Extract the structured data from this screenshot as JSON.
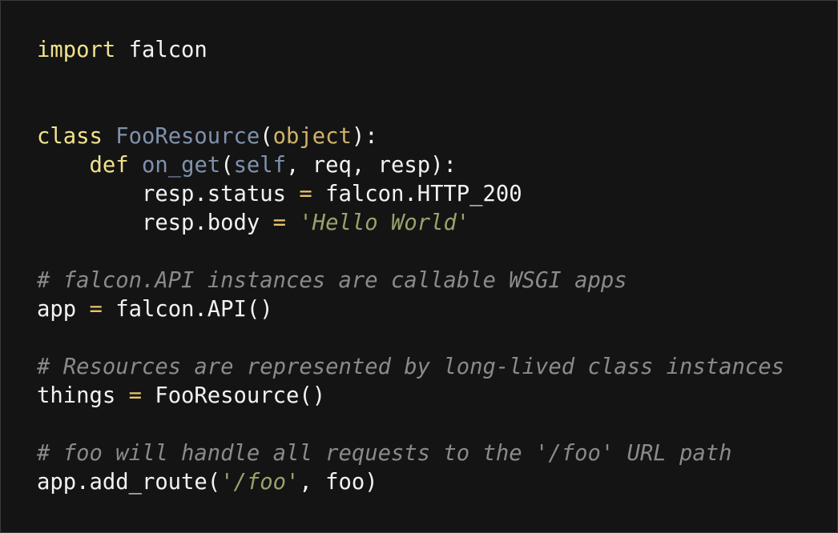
{
  "code": {
    "language": "python",
    "colors": {
      "background": "#141414",
      "keyword": "#f0e28c",
      "classname": "#7f91ad",
      "builtin": "#d0b26a",
      "operator": "#e8c46a",
      "string": "#9aa26a",
      "comment": "#8a8a8a",
      "text": "#f2f2f2"
    },
    "lines": [
      [
        {
          "t": "import",
          "k": "keyword"
        },
        {
          "t": " falcon",
          "k": "plain"
        }
      ],
      [],
      [],
      [
        {
          "t": "class",
          "k": "keyword"
        },
        {
          "t": " ",
          "k": "plain"
        },
        {
          "t": "FooResource",
          "k": "classname"
        },
        {
          "t": "(",
          "k": "plain"
        },
        {
          "t": "object",
          "k": "builtin"
        },
        {
          "t": "):",
          "k": "plain"
        }
      ],
      [
        {
          "t": "    ",
          "k": "plain"
        },
        {
          "t": "def",
          "k": "keyword"
        },
        {
          "t": " ",
          "k": "plain"
        },
        {
          "t": "on_get",
          "k": "func"
        },
        {
          "t": "(",
          "k": "plain"
        },
        {
          "t": "self",
          "k": "self"
        },
        {
          "t": ", req, resp):",
          "k": "plain"
        }
      ],
      [
        {
          "t": "        resp.status ",
          "k": "plain"
        },
        {
          "t": "=",
          "k": "op"
        },
        {
          "t": " falcon.HTTP_200",
          "k": "plain"
        }
      ],
      [
        {
          "t": "        resp.body ",
          "k": "plain"
        },
        {
          "t": "=",
          "k": "op"
        },
        {
          "t": " ",
          "k": "plain"
        },
        {
          "t": "'Hello World'",
          "k": "string"
        }
      ],
      [],
      [
        {
          "t": "# falcon.API instances are callable WSGI apps",
          "k": "comment"
        }
      ],
      [
        {
          "t": "app ",
          "k": "plain"
        },
        {
          "t": "=",
          "k": "op"
        },
        {
          "t": " falcon.API()",
          "k": "plain"
        }
      ],
      [],
      [
        {
          "t": "# Resources are represented by long-lived class instances",
          "k": "comment"
        }
      ],
      [
        {
          "t": "things ",
          "k": "plain"
        },
        {
          "t": "=",
          "k": "op"
        },
        {
          "t": " FooResource()",
          "k": "plain"
        }
      ],
      [],
      [
        {
          "t": "# foo will handle all requests to the '/foo' URL path",
          "k": "comment"
        }
      ],
      [
        {
          "t": "app.add_route(",
          "k": "plain"
        },
        {
          "t": "'/foo'",
          "k": "string"
        },
        {
          "t": ", foo)",
          "k": "plain"
        }
      ]
    ]
  }
}
